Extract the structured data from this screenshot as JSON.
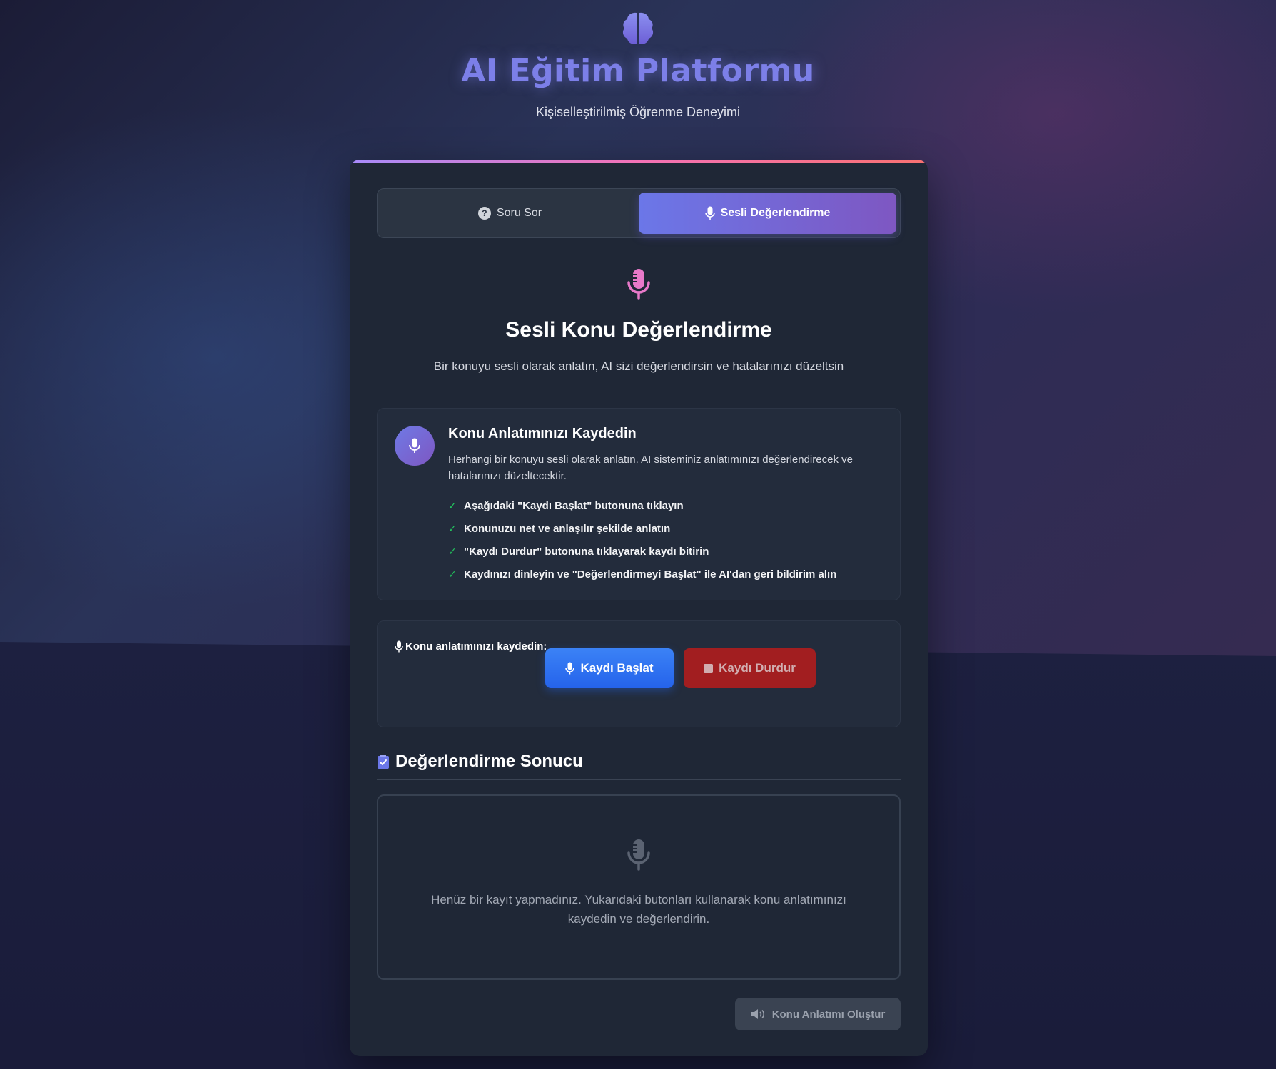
{
  "header": {
    "title": "AI Eğitim Platformu",
    "subtitle": "Kişiselleştirilmiş Öğrenme Deneyimi",
    "logo_icon": "brain-icon"
  },
  "tabs": [
    {
      "label": "Soru Sor",
      "icon": "question-circle-icon",
      "active": false
    },
    {
      "label": "Sesli Değerlendirme",
      "icon": "microphone-icon",
      "active": true
    }
  ],
  "hero": {
    "title": "Sesli Konu Değerlendirme",
    "description": "Bir konuyu sesli olarak anlatın, AI sizi değerlendirsin ve hatalarınızı düzeltsin"
  },
  "info": {
    "title": "Konu Anlatımınızı Kaydedin",
    "text": "Herhangi bir konuyu sesli olarak anlatın. AI sisteminiz anlatımınızı değerlendirecek ve hatalarınızı düzeltecektir.",
    "steps": [
      "Aşağıdaki \"Kaydı Başlat\" butonuna tıklayın",
      "Konunuzu net ve anlaşılır şekilde anlatın",
      "\"Kaydı Durdur\" butonuna tıklayarak kaydı bitirin",
      "Kaydınızı dinleyin ve \"Değerlendirmeyi Başlat\" ile AI'dan geri bildirim alın"
    ]
  },
  "recorder": {
    "label": "Konu anlatımınızı kaydedin:",
    "start_label": "Kaydı Başlat",
    "stop_label": "Kaydı Durdur"
  },
  "result": {
    "title": "Değerlendirme Sonucu",
    "empty_text": "Henüz bir kayıt yapmadınız. Yukarıdaki butonları kullanarak konu anlatımınızı kaydedin ve değerlendirin.",
    "generate_label": "Konu Anlatımı Oluştur"
  },
  "colors": {
    "accent": "#7c7fe8",
    "tab_active_start": "#6b77e8",
    "tab_active_end": "#7e57c2",
    "start_button": "#2563eb",
    "stop_button": "#b91c1c",
    "check": "#22c55e",
    "hero_mic": "#e879c9"
  }
}
